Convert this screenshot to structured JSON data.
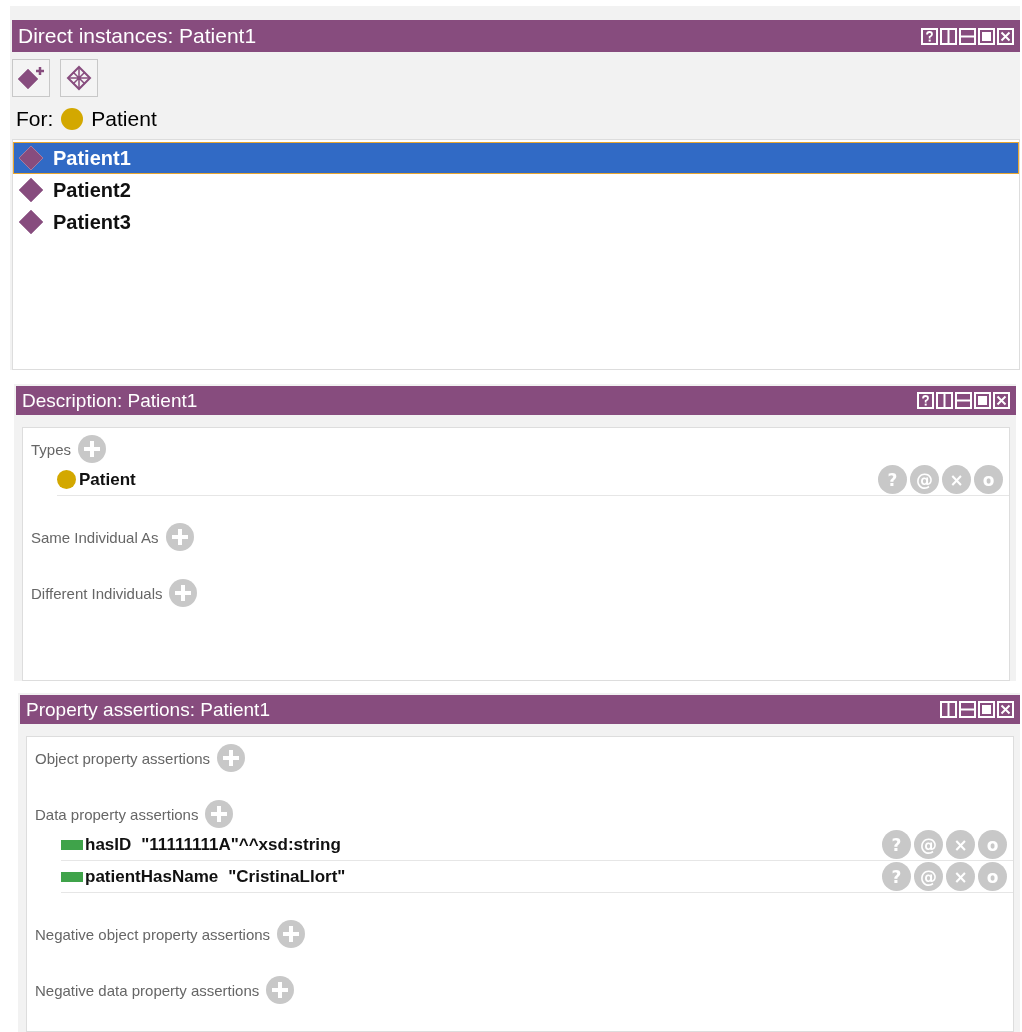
{
  "instances": {
    "title": "Direct instances: Patient1",
    "window_buttons": [
      {
        "kind": "help"
      },
      {
        "kind": "split_v"
      },
      {
        "kind": "split_h"
      },
      {
        "kind": "max"
      },
      {
        "kind": "close"
      }
    ],
    "toolbar": [
      {
        "kind": "add"
      },
      {
        "kind": "delete"
      }
    ],
    "for_label": "For:",
    "for_class": "Patient",
    "items": [
      {
        "label": "Patient1",
        "selected": true
      },
      {
        "label": "Patient2",
        "selected": false
      },
      {
        "label": "Patient3",
        "selected": false
      }
    ]
  },
  "description": {
    "title": "Description: Patient1",
    "window_buttons": [
      {
        "kind": "help"
      },
      {
        "kind": "split_v"
      },
      {
        "kind": "split_h"
      },
      {
        "kind": "max"
      },
      {
        "kind": "close"
      }
    ],
    "sections": [
      {
        "label": "Types",
        "items": [
          {
            "kind": "class",
            "name": "Patient",
            "actions": [
              "?",
              "@",
              "×",
              "o"
            ]
          }
        ]
      },
      {
        "label": "Same Individual As"
      },
      {
        "label": "Different Individuals"
      }
    ]
  },
  "properties": {
    "title": "Property assertions: Patient1",
    "window_buttons": [
      {
        "kind": "split_v"
      },
      {
        "kind": "split_h"
      },
      {
        "kind": "max"
      },
      {
        "kind": "close"
      }
    ],
    "sections": [
      {
        "label": "Object property assertions"
      },
      {
        "label": "Data property assertions",
        "items": [
          {
            "kind": "data",
            "name": "hasID",
            "value": "\"11111111A\"^^xsd:string",
            "actions": [
              "?",
              "@",
              "×",
              "o"
            ]
          },
          {
            "kind": "data",
            "name": "patientHasName",
            "value": "\"CristinaLlort\"",
            "actions": [
              "?",
              "@",
              "×",
              "o"
            ]
          }
        ]
      },
      {
        "label": "Negative object property assertions"
      },
      {
        "label": "Negative data property assertions"
      }
    ]
  }
}
